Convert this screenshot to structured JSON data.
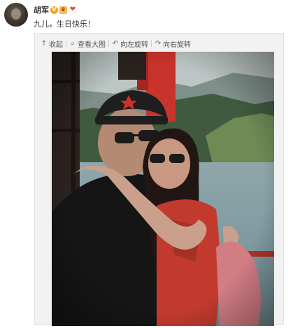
{
  "user": {
    "name": "胡军",
    "badges": [
      "vip-v-icon",
      "crown-icon",
      "balloon-icon"
    ],
    "badge_glyphs": {
      "v": "V",
      "crown": "♛",
      "balloon": "❤"
    }
  },
  "post": {
    "text": "九儿，生日快乐！"
  },
  "toolbar": {
    "collapse": {
      "icon": "↑",
      "label": "收起"
    },
    "view_large": {
      "icon": "⌕",
      "label": "查看大图"
    },
    "rotate_left": {
      "icon": "↶",
      "label": "向左旋转"
    },
    "rotate_right": {
      "icon": "↷",
      "label": "向右旋转"
    }
  },
  "photo": {
    "description_icon": "photo-image"
  },
  "colors": {
    "accent_v": "#f5a623",
    "text": "#333333",
    "card_bg": "#f2f2f2"
  }
}
